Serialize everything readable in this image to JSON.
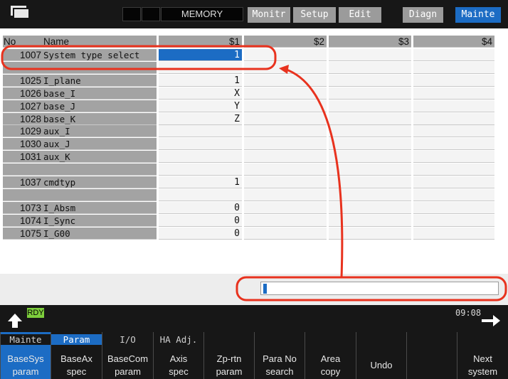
{
  "topbar": {
    "mode": "MEMORY",
    "tabs": [
      {
        "label": "Monitr",
        "active": false
      },
      {
        "label": "Setup",
        "active": false
      },
      {
        "label": "Edit",
        "active": false
      },
      {
        "label": "Diagn",
        "active": false
      },
      {
        "label": "Mainte",
        "active": true
      }
    ]
  },
  "table": {
    "headers": {
      "no": "No",
      "name": "Name",
      "s1": "$1",
      "s2": "$2",
      "s3": "$3",
      "s4": "$4"
    },
    "rows": [
      {
        "no": "1007",
        "name": "System type select",
        "s1": "1",
        "selected": true
      },
      {
        "no": "",
        "name": "",
        "s1": ""
      },
      {
        "no": "1025",
        "name": "I_plane",
        "s1": "1"
      },
      {
        "no": "1026",
        "name": "base_I",
        "s1": "X"
      },
      {
        "no": "1027",
        "name": "base_J",
        "s1": "Y"
      },
      {
        "no": "1028",
        "name": "base_K",
        "s1": "Z"
      },
      {
        "no": "1029",
        "name": "aux_I",
        "s1": ""
      },
      {
        "no": "1030",
        "name": "aux_J",
        "s1": ""
      },
      {
        "no": "1031",
        "name": "aux_K",
        "s1": ""
      },
      {
        "no": "",
        "name": "",
        "s1": ""
      },
      {
        "no": "1037",
        "name": "cmdtyp",
        "s1": "1"
      },
      {
        "no": "",
        "name": "",
        "s1": ""
      },
      {
        "no": "1073",
        "name": "I_Absm",
        "s1": "0"
      },
      {
        "no": "1074",
        "name": "I_Sync",
        "s1": "0"
      },
      {
        "no": "1075",
        "name": "I_G00",
        "s1": "0"
      }
    ]
  },
  "status": {
    "rdy": "RDY",
    "time": "09:08"
  },
  "function_keys": [
    {
      "top": "Mainte",
      "top_group": false,
      "l1": "BaseSys",
      "l2": "param",
      "active": true
    },
    {
      "top": "Param",
      "top_group": true,
      "l1": "BaseAx",
      "l2": "spec",
      "active": false
    },
    {
      "top": "I/O",
      "top_group": false,
      "l1": "BaseCom",
      "l2": "param",
      "active": false
    },
    {
      "top": "HA Adj.",
      "top_group": false,
      "l1": "Axis",
      "l2": "spec",
      "active": false
    },
    {
      "top": "",
      "top_group": false,
      "l1": "Zp-rtn",
      "l2": "param",
      "active": false
    },
    {
      "top": "",
      "top_group": false,
      "l1": "Para No",
      "l2": "search",
      "active": false
    },
    {
      "top": "",
      "top_group": false,
      "l1": "Area",
      "l2": "copy",
      "active": false
    },
    {
      "top": "",
      "top_group": false,
      "single": "Undo",
      "active": false
    },
    {
      "top": "",
      "top_group": false,
      "l1": "",
      "l2": "",
      "active": false
    },
    {
      "top": "",
      "top_group": false,
      "l1": "Next",
      "l2": "system",
      "active": false
    }
  ],
  "colors": {
    "accent": "#1c6cc4",
    "annotation": "#e8321e",
    "rdy": "#7dce3c"
  },
  "icons": [
    "window-icon",
    "up-arrow-icon",
    "right-arrow-icon"
  ]
}
